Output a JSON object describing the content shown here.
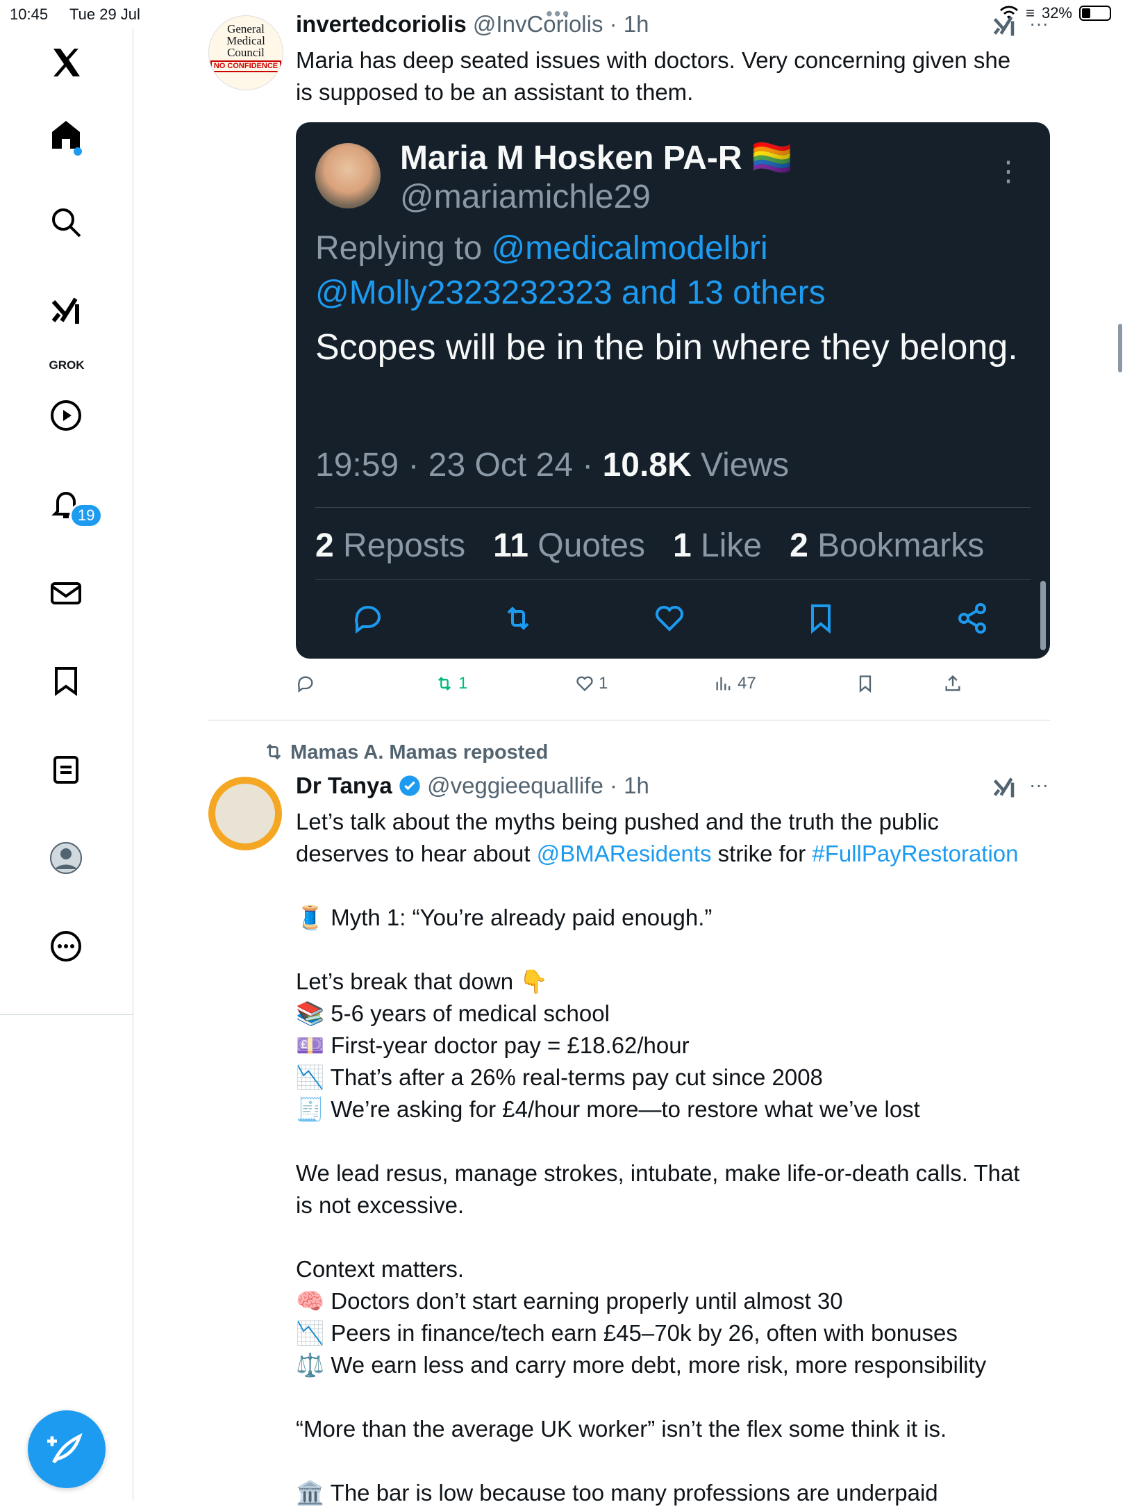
{
  "status_bar": {
    "time": "10:45",
    "date": "Tue 29 Jul",
    "battery": "32%",
    "battery_level": 0.32
  },
  "sidebar": {
    "items": [
      {
        "name": "x-logo"
      },
      {
        "name": "home",
        "has_dot": true
      },
      {
        "name": "search"
      },
      {
        "name": "grok",
        "label": "GROK"
      },
      {
        "name": "video"
      },
      {
        "name": "notifications",
        "badge": "19"
      },
      {
        "name": "messages"
      },
      {
        "name": "bookmarks"
      },
      {
        "name": "lists"
      },
      {
        "name": "profile"
      },
      {
        "name": "more"
      }
    ]
  },
  "tweet1": {
    "avatar_text_line1": "General",
    "avatar_text_line2": "Medical",
    "avatar_text_line3": "Council",
    "avatar_badge": "NO CONFIDENCE",
    "name": "invertedcoriolis",
    "handle": "@InvCoriolis",
    "time": "· 1h",
    "text": "Maria has deep seated issues with doctors. Very concerning given she\nis supposed to be an assistant to them.",
    "quote": {
      "name": "Maria M Hosken PA-R",
      "flag": "🏳️‍🌈",
      "handle": "@mariamichle29",
      "replying_prefix": "Replying to ",
      "replying_to_1": "@medicalmodelbri",
      "replying_to_2": "@Molly2323232323 and 13 others",
      "text": "Scopes will be in the bin where they belong.",
      "time_date": "19:59 · 23 Oct 24 · ",
      "views_count": "10.8K",
      "views_label": " Views",
      "reposts_count": "2",
      "reposts_label": " Reposts",
      "quotes_count": "11",
      "quotes_label": " Quotes",
      "likes_count": "1",
      "likes_label": " Like",
      "bookmarks_count": "2",
      "bookmarks_label": " Bookmarks"
    },
    "actions": {
      "reposts": "1",
      "likes": "1",
      "views": "47"
    }
  },
  "tweet2": {
    "reposted_by": "Mamas A. Mamas reposted",
    "name": "Dr Tanya",
    "handle": "@veggieequallife",
    "time": "· 1h",
    "text_intro_1": "Let’s talk about the myths being pushed and the truth the public",
    "text_intro_2_prefix": "deserves to hear about ",
    "mention": "@BMAResidents",
    "text_intro_2_mid": " strike for ",
    "hashtag": "#FullPayRestoration",
    "lines": [
      "",
      "🧵 Myth 1: “You’re already paid enough.”",
      "",
      "Let’s break that down 👇",
      "📚 5-6 years of medical school",
      "💷 First-year doctor pay = £18.62/hour",
      "📉 That’s after a 26% real-terms pay cut since 2008",
      "🧾 We’re asking for £4/hour more—to restore what we’ve lost",
      "",
      "We lead resus, manage strokes, intubate, make life-or-death calls. That",
      "is not excessive.",
      "",
      "Context matters.",
      "🧠 Doctors don’t start earning properly until almost 30",
      "📉 Peers in finance/tech earn £45–70k by 26, often with bonuses",
      "⚖️ We earn less and carry more debt, more risk, more responsibility",
      "",
      "“More than the average UK worker” isn’t the flex some think it is.",
      "",
      "🏛️ The bar is low because too many professions are underpaid"
    ]
  },
  "colors": {
    "accent": "#1d9bf0",
    "repost_green": "#00ba7c",
    "dark_card": "#15202b"
  }
}
